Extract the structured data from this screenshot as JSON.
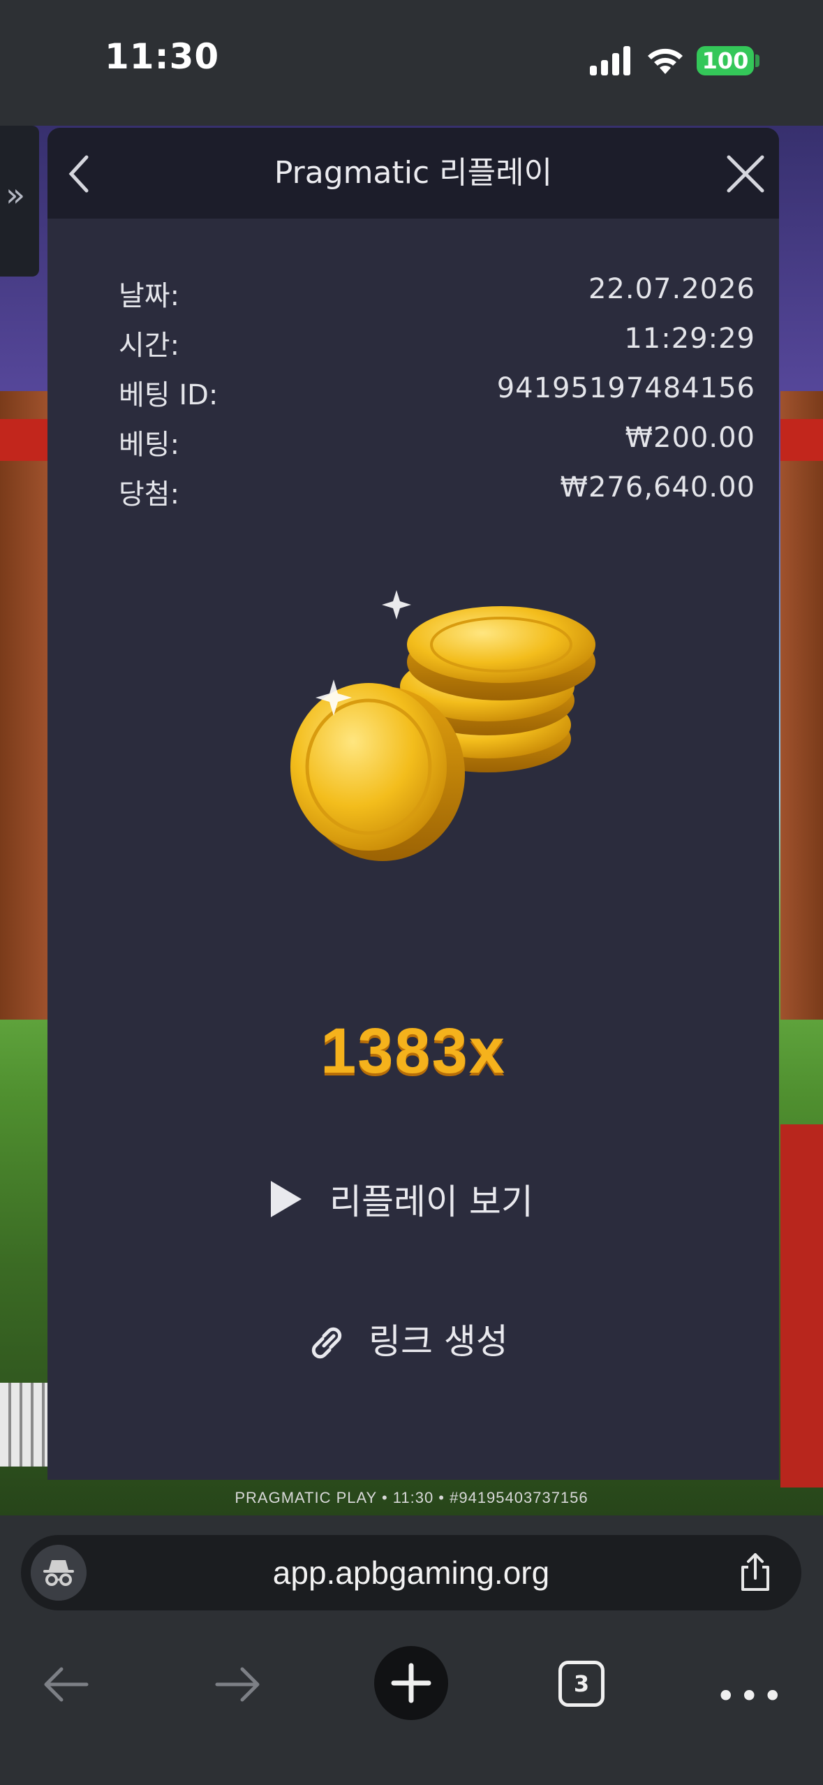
{
  "status_bar": {
    "time": "11:30",
    "battery": "100"
  },
  "game": {
    "footer_text": "PRAGMATIC PLAY • 11:30 • #94195403737156"
  },
  "modal": {
    "title": "Pragmatic 리플레이",
    "info": [
      {
        "label": "날짜:",
        "value": "22.07.2026"
      },
      {
        "label": "시간:",
        "value": "11:29:29"
      },
      {
        "label": "베팅 ID:",
        "value": "94195197484156"
      },
      {
        "label": "베팅:",
        "value": "₩200.00"
      },
      {
        "label": "당첨:",
        "value": "₩276,640.00"
      }
    ],
    "multiplier": "1383x",
    "replay_label": "리플레이 보기",
    "link_label": "링크 생성"
  },
  "browser": {
    "url": "app.apbgaming.org",
    "tab_count": "3"
  },
  "colors": {
    "modal_bg": "#2b2c3d",
    "header_bg": "#1c1d2a",
    "multiplier": "#f5b21c",
    "battery": "#34c759"
  }
}
